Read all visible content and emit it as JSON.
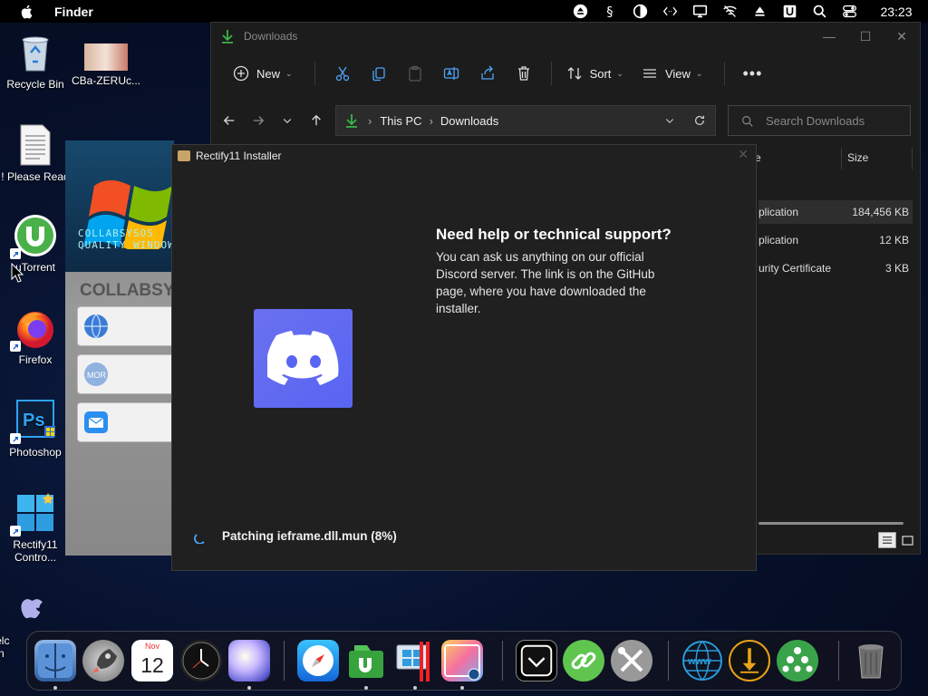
{
  "menubar": {
    "app_name": "Finder",
    "clock": "23:23",
    "status_icons": [
      "eject-icon",
      "dollar-icon",
      "pie-icon",
      "code-icon",
      "display-icon",
      "wifi-off-icon",
      "upload-icon",
      "u-icon",
      "search-icon",
      "control-center-icon"
    ]
  },
  "desktop": {
    "icons": [
      {
        "label": "Recycle Bin"
      },
      {
        "label": "CBa-ZERUc..."
      },
      {
        "label": "! Please Read"
      },
      {
        "label": "uTorrent"
      },
      {
        "label": "Firefox"
      },
      {
        "label": "Photoshop"
      },
      {
        "label": "Rectify11 Contro..."
      },
      {
        "label": "Welc Win"
      }
    ]
  },
  "explorer": {
    "title": "Downloads",
    "toolbar": {
      "new_label": "New",
      "sort_label": "Sort",
      "view_label": "View"
    },
    "address": {
      "crumbs": [
        "This PC",
        "Downloads"
      ]
    },
    "search_placeholder": "Search Downloads",
    "columns": {
      "type": "e",
      "size": "Size"
    },
    "files": [
      {
        "type": "plication",
        "size": "184,456 KB"
      },
      {
        "type": "plication",
        "size": "12 KB"
      },
      {
        "type": "urity Certificate",
        "size": "3 KB"
      }
    ]
  },
  "collab": {
    "logo_text": "COLLABSYSOS\nQUALITY WINDOW",
    "brand": "COLLABSY"
  },
  "installer": {
    "title": "Rectify11 Installer",
    "help_title": "Need help or technical support?",
    "help_body": "You can ask us anything on our official Discord server. The link is on the GitHub page, where you have downloaded the installer.",
    "status": "Patching ieframe.dll.mun (8%)"
  },
  "dock": {
    "calendar_month": "Nov",
    "calendar_day": "12"
  },
  "colors": {
    "discord": "#5865f2",
    "accent_green": "#39b54a"
  }
}
